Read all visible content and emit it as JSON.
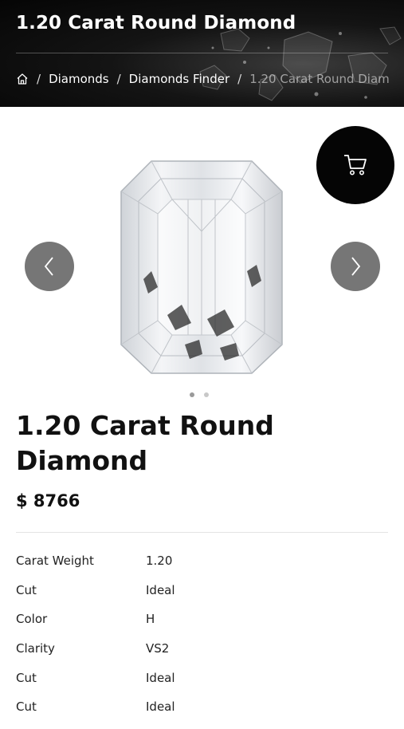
{
  "header": {
    "title": "1.20 Carat Round Diamond",
    "breadcrumb": {
      "home_icon": "home-icon",
      "separator": "/",
      "items": [
        "Diamonds",
        "Diamonds Finder"
      ],
      "current": "1.20 Carat Round Diam"
    }
  },
  "gallery": {
    "prev_icon": "chevron-left-icon",
    "next_icon": "chevron-right-icon",
    "cart_icon": "cart-icon",
    "slide_count": 2,
    "active_slide": 1
  },
  "product": {
    "title": "1.20 Carat Round Diamond",
    "price": "$ 8766"
  },
  "specs": [
    {
      "label": "Carat Weight",
      "value": "1.20"
    },
    {
      "label": "Cut",
      "value": "Ideal"
    },
    {
      "label": "Color",
      "value": "H"
    },
    {
      "label": "Clarity",
      "value": "VS2"
    },
    {
      "label": "Cut",
      "value": "Ideal"
    },
    {
      "label": "Cut",
      "value": "Ideal"
    }
  ],
  "colors": {
    "header_bg": "#050505",
    "nav_button": "#767676",
    "cart_button": "#050505",
    "text": "#111111"
  }
}
